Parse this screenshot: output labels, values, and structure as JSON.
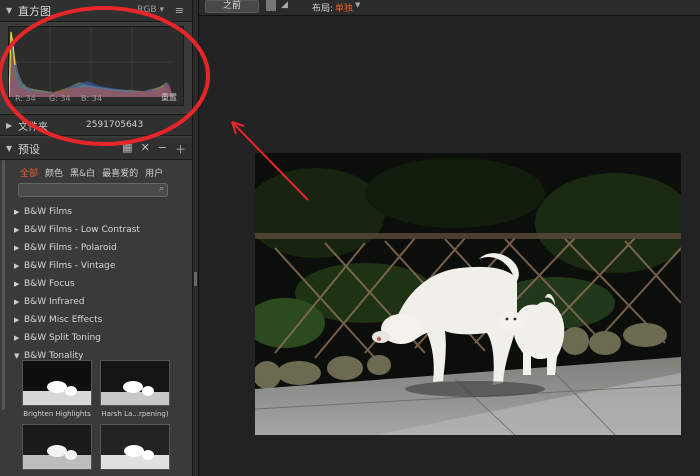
{
  "histogram": {
    "title": "直方图",
    "channel": "RGB",
    "r": "R: 34",
    "g": "G: 34",
    "b": "B: 34",
    "reset": "重置"
  },
  "folder": {
    "label": "文件夹",
    "name": "2591705643"
  },
  "presets": {
    "title": "预设",
    "filters": [
      "全部",
      "颜色",
      "黑&白",
      "最喜爱的",
      "用户"
    ],
    "search_placeholder": "",
    "items": [
      "B&W Films",
      "B&W Films - Low Contrast",
      "B&W Films - Polaroid",
      "B&W Films - Vintage",
      "B&W Focus",
      "B&W Infrared",
      "B&W Misc Effects",
      "B&W Split Toning",
      "B&W Tonality"
    ],
    "thumbs": [
      "Brighten Highlights",
      "Harsh La...rpening)",
      "",
      ""
    ]
  },
  "toolbar": {
    "before": "之前",
    "layout_label": "布局:",
    "layout_value": "单独"
  },
  "colors": {
    "accent": "#e0602a",
    "annotation": "#e8262a"
  }
}
